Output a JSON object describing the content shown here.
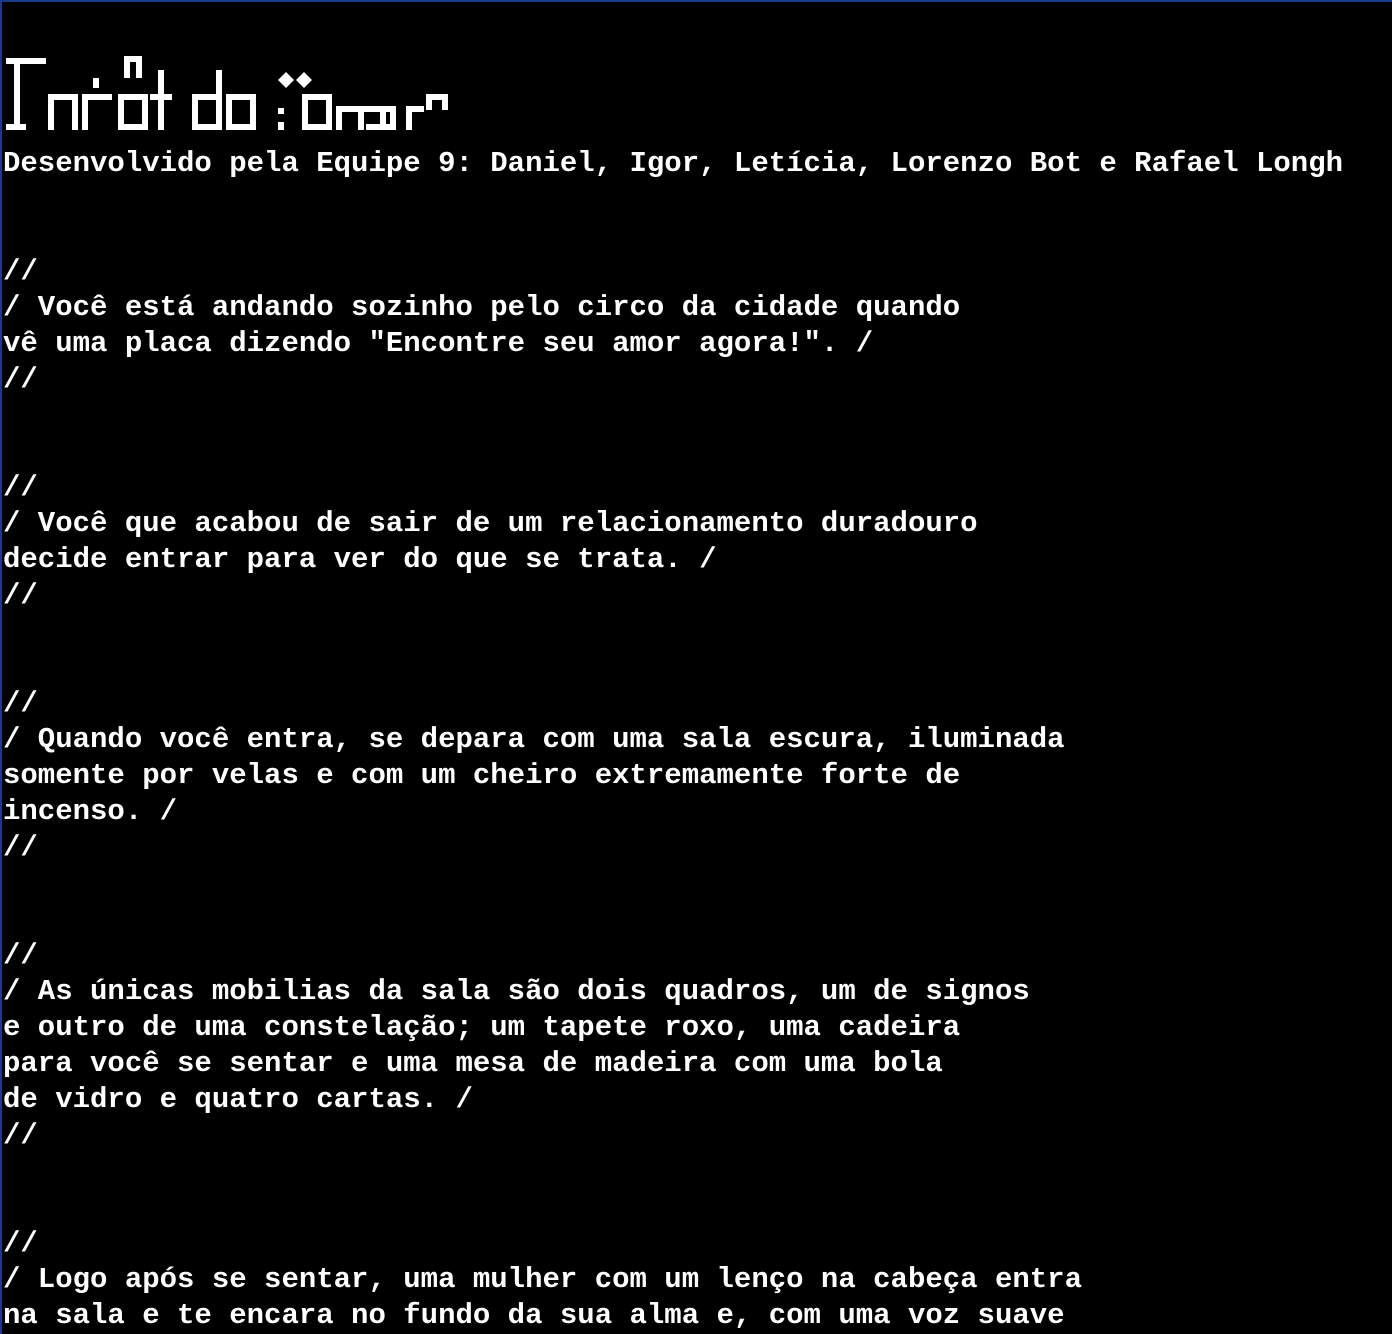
{
  "banner": {
    "title": "Tarot do Amor"
  },
  "credits": "Desenvolvido pela Equipe 9: Daniel, Igor, Letícia, Lorenzo Bot e Rafael Longh",
  "blocks": [
    {
      "open": "//",
      "lines": [
        "/ Você está andando sozinho pelo circo da cidade quando",
        "vê uma placa dizendo \"Encontre seu amor agora!\". /"
      ],
      "close": "//"
    },
    {
      "open": "//",
      "lines": [
        "/ Você que acabou de sair de um relacionamento duradouro",
        "decide entrar para ver do que se trata. /"
      ],
      "close": "//"
    },
    {
      "open": "//",
      "lines": [
        "/ Quando você entra, se depara com uma sala escura, iluminada",
        "somente por velas e com um cheiro extremamente forte de",
        "incenso. /"
      ],
      "close": "//"
    },
    {
      "open": "//",
      "lines": [
        "/ As únicas mobilias da sala são dois quadros, um de signos",
        "e outro de uma constelação; um tapete roxo, uma cadeira",
        "para você se sentar e uma mesa de madeira com uma bola",
        "de vidro e quatro cartas. /"
      ],
      "close": "//"
    },
    {
      "open": "//",
      "lines": [
        "/ Logo após se sentar, uma mulher com um lenço na cabeça entra",
        "na sala e te encara no fundo da sua alma e, com uma voz suave"
      ],
      "close": ""
    }
  ],
  "colors": {
    "background": "#000000",
    "text": "#ffffff",
    "frame": "#1a3a8c"
  }
}
